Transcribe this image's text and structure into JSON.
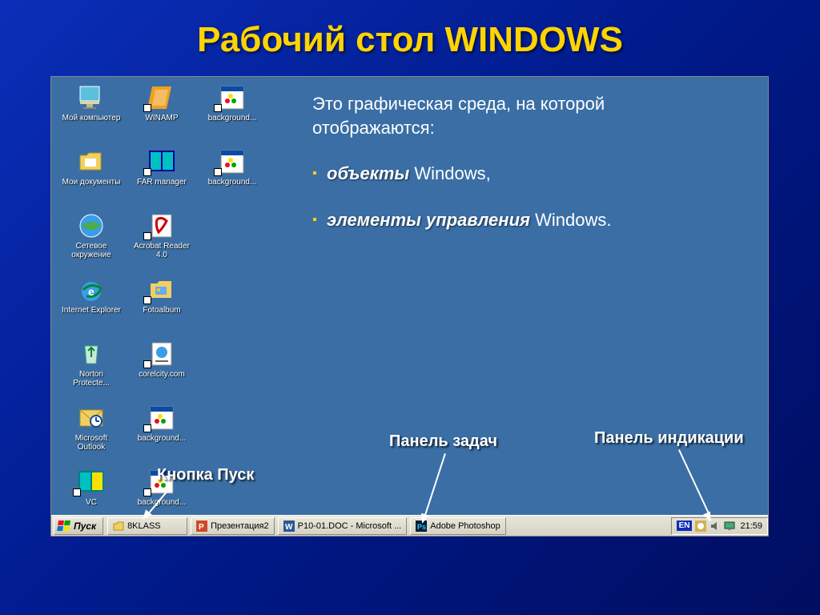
{
  "title": "Рабочий стол WINDOWS",
  "description": {
    "intro": "Это графическая среда, на которой отображаются:",
    "bullet1_em": "объекты",
    "bullet1_rest": " Windows,",
    "bullet2_em": "элементы управления",
    "bullet2_rest": " Windows."
  },
  "callouts": {
    "start_button": "Кнопка Пуск",
    "taskbar": "Панель задач",
    "systray": "Панель индикации"
  },
  "desktop_icons": [
    [
      {
        "name": "my-computer",
        "label": "Мой компьютер",
        "glyph": "monitor",
        "shortcut": false
      },
      {
        "name": "winamp",
        "label": "WINAMP",
        "glyph": "winamp",
        "shortcut": true
      },
      {
        "name": "background1",
        "label": "background...",
        "glyph": "paint",
        "shortcut": true
      }
    ],
    [
      {
        "name": "my-documents",
        "label": "Мои документы",
        "glyph": "folder-docs",
        "shortcut": false
      },
      {
        "name": "far-manager",
        "label": "FAR manager",
        "glyph": "far",
        "shortcut": true
      },
      {
        "name": "background2",
        "label": "background...",
        "glyph": "paint",
        "shortcut": true
      }
    ],
    [
      {
        "name": "network-places",
        "label": "Сетевое окружение",
        "glyph": "network",
        "shortcut": false
      },
      {
        "name": "acrobat-reader",
        "label": "Acrobat Reader 4.0",
        "glyph": "acrobat",
        "shortcut": true
      }
    ],
    [
      {
        "name": "internet-explorer",
        "label": "Internet Explorer",
        "glyph": "ie",
        "shortcut": false
      },
      {
        "name": "fotoalbum",
        "label": "Fotoalbum",
        "glyph": "folder-photo",
        "shortcut": true
      }
    ],
    [
      {
        "name": "norton-protected",
        "label": "Norton Protecte...",
        "glyph": "recycle",
        "shortcut": false
      },
      {
        "name": "corelcity",
        "label": "corelcity.com",
        "glyph": "webdoc",
        "shortcut": true
      }
    ],
    [
      {
        "name": "outlook",
        "label": "Microsoft Outlook",
        "glyph": "outlook",
        "shortcut": false
      },
      {
        "name": "background3",
        "label": "background...",
        "glyph": "paint",
        "shortcut": true
      }
    ],
    [
      {
        "name": "vc",
        "label": "VC",
        "glyph": "vc",
        "shortcut": true
      },
      {
        "name": "background4",
        "label": "background...",
        "glyph": "paint",
        "shortcut": true
      }
    ]
  ],
  "taskbar": {
    "start_label": "Пуск",
    "items": [
      {
        "name": "task-8klass",
        "label": "8KLASS",
        "icon": "folder"
      },
      {
        "name": "task-presentation",
        "label": "Презентация2",
        "icon": "ppt"
      },
      {
        "name": "task-word",
        "label": "P10-01.DOC - Microsoft ...",
        "icon": "word"
      },
      {
        "name": "task-photoshop",
        "label": "Adobe Photoshop",
        "icon": "ps"
      }
    ],
    "tray": {
      "lang": "EN",
      "clock": "21:59"
    }
  }
}
